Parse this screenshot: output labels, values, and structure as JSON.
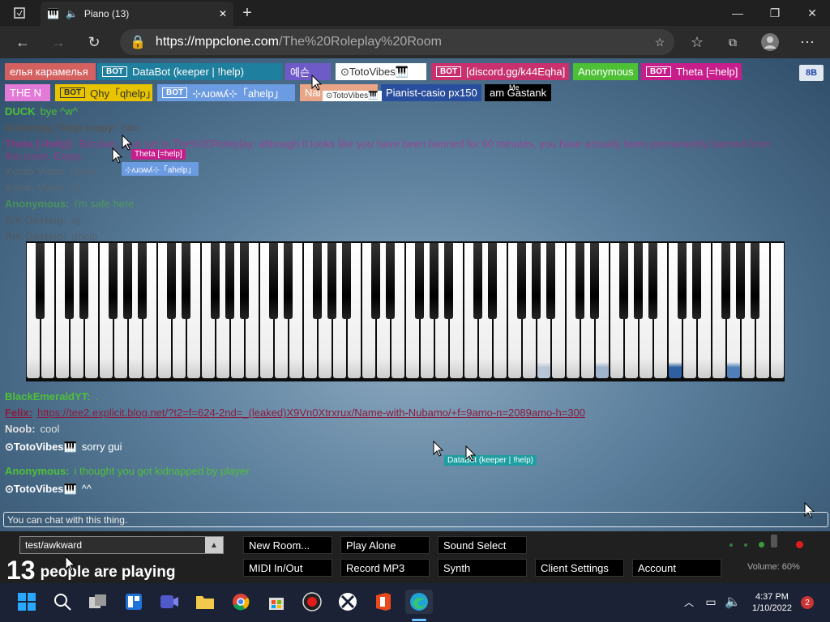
{
  "browser": {
    "tab_title": "Piano (13)",
    "url_host": "https://mppclone.com",
    "url_path": "/The%20Roleplay%20Room"
  },
  "users": [
    {
      "name": "елья карамелья",
      "bot": false,
      "color": "#d46060"
    },
    {
      "name": "DataBot (keeper | !help)",
      "bot": true,
      "color": "#1e7f9e"
    },
    {
      "name": "예슨",
      "bot": false,
      "color": "#6f5bc8"
    },
    {
      "name": "⊙TotoVibes🎹",
      "bot": false,
      "color": "#ffffff"
    },
    {
      "name": "[discord.gg/k44Eqha]",
      "bot": true,
      "color": "#c8306e"
    },
    {
      "name": "Anonymous",
      "bot": false,
      "color": "#4ec036"
    },
    {
      "name": "Theta [=help]",
      "bot": true,
      "color": "#c71e8c"
    },
    {
      "name": "THE N",
      "bot": false,
      "color": "#e37ad8"
    },
    {
      "name": "Qhy「qhelp」",
      "bot": true,
      "color": "#e8c400"
    },
    {
      "name": "⊹ʌɹoʍʎ⊹「ahelp」",
      "bot": true,
      "color": "#6b9be0"
    },
    {
      "name": "Nai",
      "bot": false,
      "color": "#e9a587"
    },
    {
      "name": "Pianist-casio px150",
      "bot": false,
      "color": "#2a4e9e"
    },
    {
      "name": "am Gastank",
      "bot": false,
      "color": "#000000"
    }
  ],
  "user_count_badge": "8B",
  "me_label": "Me",
  "chat": [
    {
      "name": "DUCK",
      "msg": "bye ^w^",
      "color": "#4ec036"
    },
    {
      "name": "Autocopy !loop !copy:",
      "msg": "hoo",
      "color": "#555555"
    },
    {
      "name": "Theta [=help]:",
      "msg": "Bot.ban_chat set to The%20Roleplay: although it looks like you have been banned for 60 minutes, you have actually been permanently banned from this room. Enjoy.",
      "color": "#c71e8c"
    },
    {
      "name": "Kolab Viem:",
      "msg": "clown",
      "color": "#666666"
    },
    {
      "name": "Kolab Viem:",
      "msg": "df",
      "color": "#666666"
    },
    {
      "name": "Anonymous:",
      "msg": "i'm safe here",
      "color": "#4ec036"
    },
    {
      "name": "Am Gasteig:",
      "msg": "qj",
      "color": "#555555"
    },
    {
      "name": "Am Gasteig:",
      "msg": "ghelp",
      "color": "#555555"
    },
    {
      "name": "BlackEmeraldYT:",
      "msg": ".",
      "color": "#4ec036"
    },
    {
      "name": "Felix:",
      "msg": "https://tee2.explicit.blog.net/?t2=f=624-2nd=_(leaked)X9Vn0Xtrxrux/Name-with-Nubamo/+f=9amo-n=2089amo-h=300",
      "color": "#8b1c40"
    },
    {
      "name": "Noob:",
      "msg": "cool",
      "color": "#e0e0e0"
    },
    {
      "name": "⊙TotoVibes🎹",
      "msg": "sorry gui",
      "color": "#ffffff"
    },
    {
      "name": "Anonymous:",
      "msg": "i thought you got kidnapped by player",
      "color": "#4ec036"
    },
    {
      "name": "⊙TotoVibes🎹",
      "msg": "^^",
      "color": "#ffffff"
    }
  ],
  "floating_labels": [
    {
      "text": "Theta [=help]",
      "color": "#c71e8c"
    },
    {
      "text": "⊹ʌɹoʍʎ⊹「ahelp」",
      "color": "#6b9be0"
    },
    {
      "text": "⊙TotoVibes🎹",
      "color": "#ffffff"
    },
    {
      "text": "DataBot (keeper | !help)",
      "color": "#1e9ea0"
    },
    {
      "text": "NajdorfBritian",
      "color": "#e9a587"
    }
  ],
  "chat_placeholder": "You can chat with this thing.",
  "room_select": "test/awkward",
  "players": {
    "count": "13",
    "label": "people are playing"
  },
  "buttons": [
    "New Room...",
    "Play Alone",
    "Sound Select",
    "MIDI In/Out",
    "Record MP3",
    "Synth",
    "Client Settings",
    "Account"
  ],
  "volume": "Volume: 60%",
  "clock": {
    "time": "4:37 PM",
    "date": "1/10/2022"
  },
  "notifications": "2",
  "icons": [
    "window-icon",
    "piano-icon",
    "speaker-icon",
    "close-icon",
    "plus-icon",
    "back-icon",
    "forward-icon",
    "refresh-icon",
    "lock-icon",
    "add-favorite-icon",
    "favorites-icon",
    "collections-icon",
    "profile-icon",
    "menu-icon"
  ]
}
